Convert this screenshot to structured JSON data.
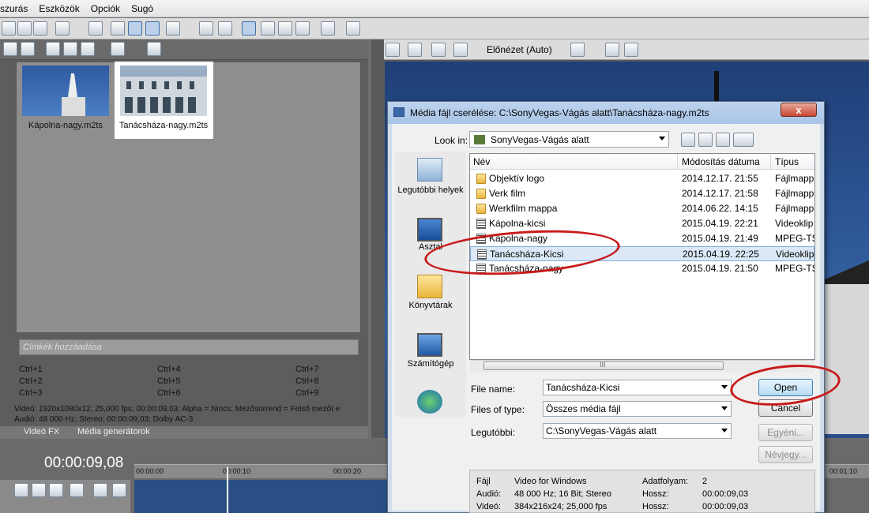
{
  "menu": [
    "szurás",
    "Eszközök",
    "Opciók",
    "Sugó"
  ],
  "preview_toolbar": {
    "mode_label": "Előnézet (Auto)"
  },
  "media": {
    "thumbs": [
      {
        "label": "Kápolna-nagy.m2ts"
      },
      {
        "label": "Tanácsháza-nagy.m2ts"
      }
    ],
    "tag_placeholder": "Címkék hozzáadása",
    "shortcuts": [
      "Ctrl+1",
      "Ctrl+4",
      "Ctrl+7",
      "Ctrl+2",
      "Ctrl+5",
      "Ctrl+8",
      "Ctrl+3",
      "Ctrl+6",
      "Ctrl+9"
    ],
    "info_video": "Videó: 1920x1080x12; 25,000 fps; 00:00:09,03; Alpha = Nincs; Mezősorrend = Felső mezőt e",
    "info_audio": "Audió: 48 000 Hz; Stereo; 00:00:09,03; Dolby AC-3",
    "tabs": [
      "Videó FX",
      "Média generátorok"
    ]
  },
  "timeline": {
    "timecode": "00:00:09,08",
    "ruler": [
      "00:00:00",
      "00:00:10",
      "00:00:20",
      "00:01:10"
    ]
  },
  "dialog": {
    "title": "Média fájl cserélése: C:\\SonyVegas-Vágás alatt\\Tanácsháza-nagy.m2ts",
    "close": "x",
    "look_in_label": "Look in:",
    "look_in_value": "SonyVegas-Vágás alatt",
    "places": [
      "Legutóbbi helyek",
      "Asztal",
      "Könyvtárak",
      "Számítógép"
    ],
    "columns": [
      "Név",
      "Módosítás dátuma",
      "Típus"
    ],
    "files": [
      {
        "name": "Objektív logo",
        "date": "2014.12.17. 21:55",
        "type": "Fájlmappa",
        "kind": "folder"
      },
      {
        "name": "Verk film",
        "date": "2014.12.17. 21:58",
        "type": "Fájlmappa",
        "kind": "folder"
      },
      {
        "name": "Werkfilm mappa",
        "date": "2014.06.22. 14:15",
        "type": "Fájlmappa",
        "kind": "folder"
      },
      {
        "name": "Kápolna-kicsi",
        "date": "2015.04.19. 22:21",
        "type": "Videoklip",
        "kind": "video"
      },
      {
        "name": "Kápolna-nagy",
        "date": "2015.04.19. 21:49",
        "type": "MPEG-TS",
        "kind": "video"
      },
      {
        "name": "Tanácsháza-Kicsi",
        "date": "2015.04.19. 22:25",
        "type": "Videoklip",
        "kind": "video"
      },
      {
        "name": "Tanácsháza-nagy",
        "date": "2015.04.19. 21:50",
        "type": "MPEG-TS",
        "kind": "video"
      }
    ],
    "scroll_grip": "III",
    "file_name_label": "File name:",
    "file_name_value": "Tanácsháza-Kicsi",
    "file_type_label": "Files of type:",
    "file_type_value": "Összes média fájl",
    "recent_label": "Legutóbbi:",
    "recent_value": "C:\\SonyVegas-Vágás alatt",
    "open": "Open",
    "cancel": "Cancel",
    "custom": "Egyéni...",
    "details": "Névjegy...",
    "info": {
      "k1": "Fájl",
      "v1": "Video for Windows",
      "k2": "Audió:",
      "v2": "48 000 Hz; 16 Bit; Stereo",
      "k3": "Videó:",
      "v3": "384x216x24; 25,000 fps",
      "k4": "Adatfolyam:",
      "v4": "2",
      "k5": "Hossz:",
      "v5": "00:00:09,03",
      "k6": "Hossz:",
      "v6": "00:00:09,03"
    }
  },
  "colors": {
    "accent": "#3c7fb1",
    "highlight": "#c81a1a"
  }
}
